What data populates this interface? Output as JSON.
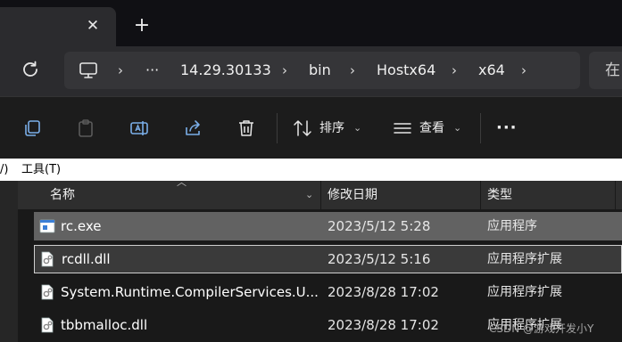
{
  "tab": {
    "close_icon": "close-icon",
    "new_tab_icon": "plus-icon"
  },
  "address_bar": {
    "segments": [
      "···",
      "14.29.30133",
      "bin",
      "Hostx64",
      "x64"
    ]
  },
  "search": {
    "text": "在"
  },
  "toolbar": {
    "sort_label": "排序",
    "view_label": "查看",
    "more_label": "···"
  },
  "menu": {
    "partial_item": "/)",
    "tools": "工具(T)"
  },
  "columns": {
    "name": "名称",
    "date": "修改日期",
    "type": "类型"
  },
  "files": [
    {
      "name": "rc.exe",
      "date": "2023/5/12 5:28",
      "type": "应用程序",
      "state": "selected"
    },
    {
      "name": "rcdll.dll",
      "date": "2023/5/12 5:16",
      "type": "应用程序扩展",
      "state": "focused"
    },
    {
      "name": "System.Runtime.CompilerServices.U...",
      "date": "2023/8/28 17:02",
      "type": "应用程序扩展",
      "state": ""
    },
    {
      "name": "tbbmalloc.dll",
      "date": "2023/8/28 17:02",
      "type": "应用程序扩展",
      "state": ""
    }
  ],
  "watermark": "CSDN @游戏开发小Y"
}
